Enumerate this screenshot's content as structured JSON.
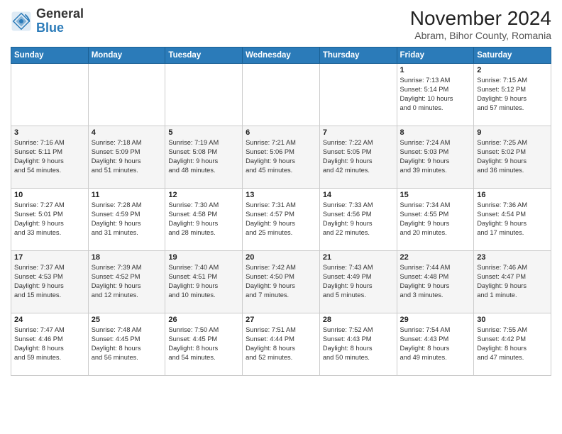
{
  "logo": {
    "general": "General",
    "blue": "Blue"
  },
  "header": {
    "month_title": "November 2024",
    "subtitle": "Abram, Bihor County, Romania"
  },
  "weekdays": [
    "Sunday",
    "Monday",
    "Tuesday",
    "Wednesday",
    "Thursday",
    "Friday",
    "Saturday"
  ],
  "weeks": [
    [
      {
        "day": "",
        "info": ""
      },
      {
        "day": "",
        "info": ""
      },
      {
        "day": "",
        "info": ""
      },
      {
        "day": "",
        "info": ""
      },
      {
        "day": "",
        "info": ""
      },
      {
        "day": "1",
        "info": "Sunrise: 7:13 AM\nSunset: 5:14 PM\nDaylight: 10 hours\nand 0 minutes."
      },
      {
        "day": "2",
        "info": "Sunrise: 7:15 AM\nSunset: 5:12 PM\nDaylight: 9 hours\nand 57 minutes."
      }
    ],
    [
      {
        "day": "3",
        "info": "Sunrise: 7:16 AM\nSunset: 5:11 PM\nDaylight: 9 hours\nand 54 minutes."
      },
      {
        "day": "4",
        "info": "Sunrise: 7:18 AM\nSunset: 5:09 PM\nDaylight: 9 hours\nand 51 minutes."
      },
      {
        "day": "5",
        "info": "Sunrise: 7:19 AM\nSunset: 5:08 PM\nDaylight: 9 hours\nand 48 minutes."
      },
      {
        "day": "6",
        "info": "Sunrise: 7:21 AM\nSunset: 5:06 PM\nDaylight: 9 hours\nand 45 minutes."
      },
      {
        "day": "7",
        "info": "Sunrise: 7:22 AM\nSunset: 5:05 PM\nDaylight: 9 hours\nand 42 minutes."
      },
      {
        "day": "8",
        "info": "Sunrise: 7:24 AM\nSunset: 5:03 PM\nDaylight: 9 hours\nand 39 minutes."
      },
      {
        "day": "9",
        "info": "Sunrise: 7:25 AM\nSunset: 5:02 PM\nDaylight: 9 hours\nand 36 minutes."
      }
    ],
    [
      {
        "day": "10",
        "info": "Sunrise: 7:27 AM\nSunset: 5:01 PM\nDaylight: 9 hours\nand 33 minutes."
      },
      {
        "day": "11",
        "info": "Sunrise: 7:28 AM\nSunset: 4:59 PM\nDaylight: 9 hours\nand 31 minutes."
      },
      {
        "day": "12",
        "info": "Sunrise: 7:30 AM\nSunset: 4:58 PM\nDaylight: 9 hours\nand 28 minutes."
      },
      {
        "day": "13",
        "info": "Sunrise: 7:31 AM\nSunset: 4:57 PM\nDaylight: 9 hours\nand 25 minutes."
      },
      {
        "day": "14",
        "info": "Sunrise: 7:33 AM\nSunset: 4:56 PM\nDaylight: 9 hours\nand 22 minutes."
      },
      {
        "day": "15",
        "info": "Sunrise: 7:34 AM\nSunset: 4:55 PM\nDaylight: 9 hours\nand 20 minutes."
      },
      {
        "day": "16",
        "info": "Sunrise: 7:36 AM\nSunset: 4:54 PM\nDaylight: 9 hours\nand 17 minutes."
      }
    ],
    [
      {
        "day": "17",
        "info": "Sunrise: 7:37 AM\nSunset: 4:53 PM\nDaylight: 9 hours\nand 15 minutes."
      },
      {
        "day": "18",
        "info": "Sunrise: 7:39 AM\nSunset: 4:52 PM\nDaylight: 9 hours\nand 12 minutes."
      },
      {
        "day": "19",
        "info": "Sunrise: 7:40 AM\nSunset: 4:51 PM\nDaylight: 9 hours\nand 10 minutes."
      },
      {
        "day": "20",
        "info": "Sunrise: 7:42 AM\nSunset: 4:50 PM\nDaylight: 9 hours\nand 7 minutes."
      },
      {
        "day": "21",
        "info": "Sunrise: 7:43 AM\nSunset: 4:49 PM\nDaylight: 9 hours\nand 5 minutes."
      },
      {
        "day": "22",
        "info": "Sunrise: 7:44 AM\nSunset: 4:48 PM\nDaylight: 9 hours\nand 3 minutes."
      },
      {
        "day": "23",
        "info": "Sunrise: 7:46 AM\nSunset: 4:47 PM\nDaylight: 9 hours\nand 1 minute."
      }
    ],
    [
      {
        "day": "24",
        "info": "Sunrise: 7:47 AM\nSunset: 4:46 PM\nDaylight: 8 hours\nand 59 minutes."
      },
      {
        "day": "25",
        "info": "Sunrise: 7:48 AM\nSunset: 4:45 PM\nDaylight: 8 hours\nand 56 minutes."
      },
      {
        "day": "26",
        "info": "Sunrise: 7:50 AM\nSunset: 4:45 PM\nDaylight: 8 hours\nand 54 minutes."
      },
      {
        "day": "27",
        "info": "Sunrise: 7:51 AM\nSunset: 4:44 PM\nDaylight: 8 hours\nand 52 minutes."
      },
      {
        "day": "28",
        "info": "Sunrise: 7:52 AM\nSunset: 4:43 PM\nDaylight: 8 hours\nand 50 minutes."
      },
      {
        "day": "29",
        "info": "Sunrise: 7:54 AM\nSunset: 4:43 PM\nDaylight: 8 hours\nand 49 minutes."
      },
      {
        "day": "30",
        "info": "Sunrise: 7:55 AM\nSunset: 4:42 PM\nDaylight: 8 hours\nand 47 minutes."
      }
    ]
  ]
}
